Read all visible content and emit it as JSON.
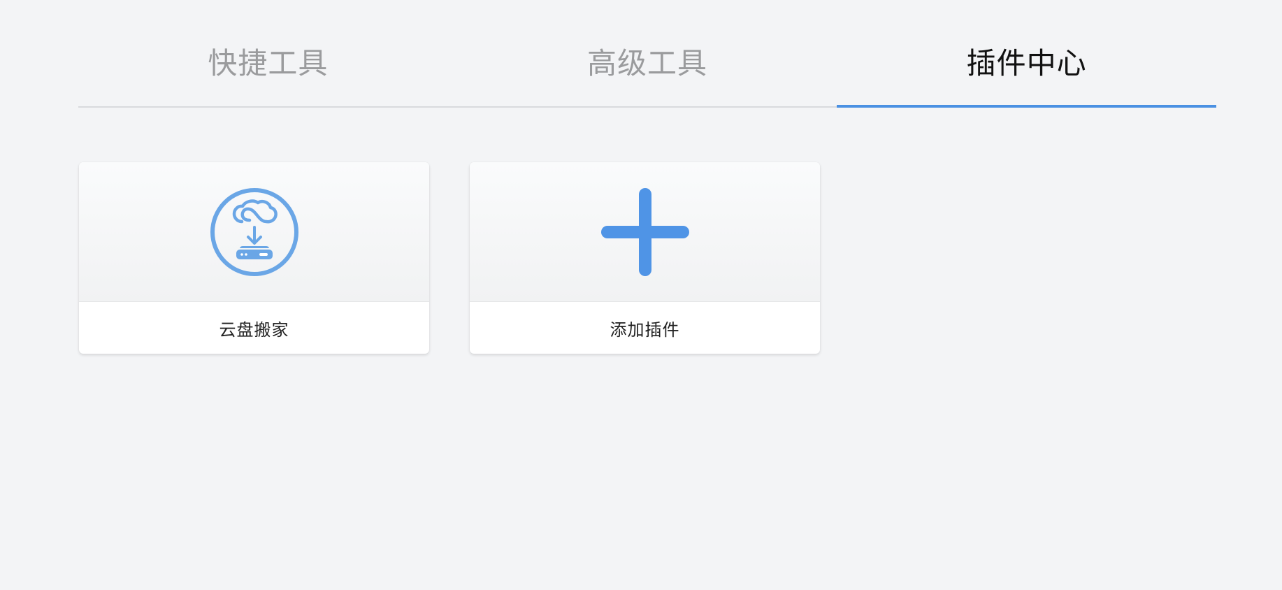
{
  "tabs": [
    {
      "label": "快捷工具",
      "active": false
    },
    {
      "label": "高级工具",
      "active": false
    },
    {
      "label": "插件中心",
      "active": true
    }
  ],
  "cards": [
    {
      "label": "云盘搬家",
      "icon": "cloud-download-circle-icon"
    },
    {
      "label": "添加插件",
      "icon": "plus-icon"
    }
  ],
  "colors": {
    "accent": "#4a90e2",
    "icon_blue": "#6aa6e6",
    "background": "#f3f4f6"
  }
}
